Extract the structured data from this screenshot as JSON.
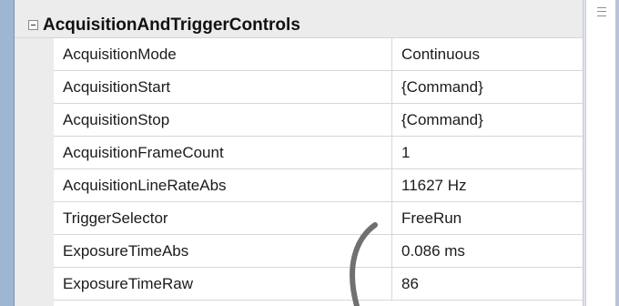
{
  "category": {
    "title": "AcquisitionAndTriggerControls",
    "expander_icon": "collapse-minus-icon"
  },
  "properties": [
    {
      "name": "AcquisitionMode",
      "value": "Continuous"
    },
    {
      "name": "AcquisitionStart",
      "value": "{Command}"
    },
    {
      "name": "AcquisitionStop",
      "value": "{Command}"
    },
    {
      "name": "AcquisitionFrameCount",
      "value": "1"
    },
    {
      "name": "AcquisitionLineRateAbs",
      "value": "11627 Hz"
    },
    {
      "name": "TriggerSelector",
      "value": "FreeRun"
    },
    {
      "name": "ExposureTimeAbs",
      "value": "0.086 ms"
    },
    {
      "name": "ExposureTimeRaw",
      "value": "86"
    }
  ],
  "scrollbar": {
    "grip_icon": "scroll-grip-icon"
  },
  "colors": {
    "frame": "#9fb6d2",
    "category_bg": "#ececec",
    "grid_line": "#d7d7d7",
    "annotation_stroke": "#707070"
  }
}
